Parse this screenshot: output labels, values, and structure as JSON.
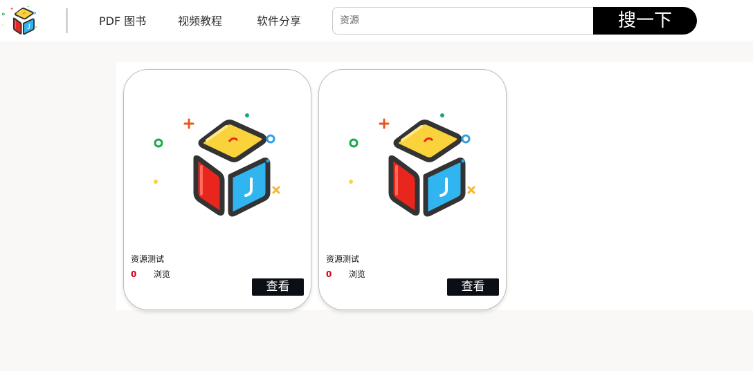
{
  "header": {
    "nav": [
      {
        "label": "PDF 图书"
      },
      {
        "label": "视频教程"
      },
      {
        "label": "软件分享"
      }
    ],
    "search": {
      "placeholder": "资源",
      "button_label": "搜一下"
    }
  },
  "cards": [
    {
      "title": "资源测试",
      "views": "0",
      "views_label": "浏览",
      "button_label": "查看"
    },
    {
      "title": "资源测试",
      "views": "0",
      "views_label": "浏览",
      "button_label": "查看"
    }
  ],
  "colors": {
    "accent": "#000000",
    "views_count": "#d0021b",
    "cube_top": "#f9d23c",
    "cube_left": "#e8261e",
    "cube_right": "#31b5f0"
  },
  "icons": [
    "logo-cube-icon",
    "cube-illustration-icon"
  ]
}
